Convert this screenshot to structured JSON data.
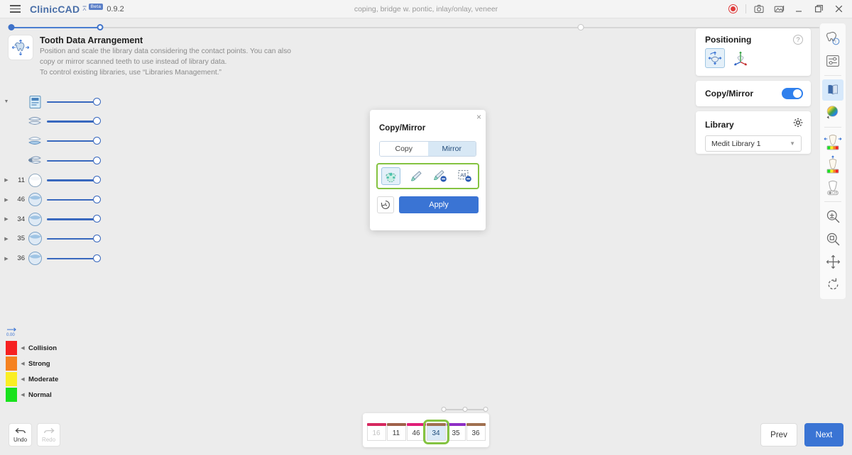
{
  "titlebar": {
    "menu_icon": "hamburger-icon",
    "brand": "ClinicCAD",
    "brand_mark": "⩞",
    "beta": "Beta",
    "version": "0.9.2",
    "center_title": "coping, bridge w. pontic, inlay/onlay, veneer",
    "controls": [
      {
        "name": "record-button",
        "label": "record"
      },
      {
        "name": "screenshot-button",
        "label": "screenshot"
      },
      {
        "name": "gallery-button",
        "label": "gallery"
      },
      {
        "name": "minimize-button",
        "label": "minimize"
      },
      {
        "name": "maximize-button",
        "label": "maximize"
      },
      {
        "name": "close-button",
        "label": "close"
      }
    ]
  },
  "stepper": {
    "nodes": [
      {
        "pos": 0,
        "state": "done"
      },
      {
        "pos": 11,
        "state": "current"
      },
      {
        "pos": 68.5,
        "state": "todo"
      },
      {
        "pos": 100,
        "state": "todo"
      }
    ],
    "fill_percent": 11
  },
  "instruction": {
    "icon": "tooth-arrange-icon",
    "title": "Tooth Data Arrangement",
    "line1": "Position and scale the library data considering the contact points. You can also",
    "line2": "copy or mirror scanned teeth to use instead of library data.",
    "line3": "To control existing libraries, use “Libraries Management.”"
  },
  "sidebar": {
    "rows": [
      {
        "caret": "down",
        "num": "",
        "icon": "document-layer-icon",
        "expanded": true
      },
      {
        "caret": "",
        "num": "",
        "icon": "upper-lower-arch-icon"
      },
      {
        "caret": "",
        "num": "",
        "icon": "lower-arch-icon"
      },
      {
        "caret": "",
        "num": "",
        "icon": "die-model-icon"
      },
      {
        "caret": "right",
        "num": "11",
        "icon": "tooth-11-icon"
      },
      {
        "caret": "right",
        "num": "46",
        "icon": "tooth-46-icon"
      },
      {
        "caret": "right",
        "num": "34",
        "icon": "tooth-34-icon"
      },
      {
        "caret": "right",
        "num": "35",
        "icon": "tooth-35-icon"
      },
      {
        "caret": "right",
        "num": "36",
        "icon": "tooth-36-icon"
      }
    ]
  },
  "legend": {
    "scale_icon": "distance-scale-icon",
    "items": [
      {
        "label": "Collision",
        "color": "#f62121"
      },
      {
        "label": "Strong",
        "color": "#f58220"
      },
      {
        "label": "Moderate",
        "color": "#faee24"
      },
      {
        "label": "Normal",
        "color": "#18e21d"
      }
    ]
  },
  "dialog": {
    "title": "Copy/Mirror",
    "close_icon": "close-icon",
    "tabs": [
      {
        "label": "Copy",
        "active": false
      },
      {
        "label": "Mirror",
        "active": true
      }
    ],
    "tools": [
      {
        "name": "auto-select-tool",
        "selected": true
      },
      {
        "name": "brush-add-tool",
        "selected": false
      },
      {
        "name": "brush-remove-tool",
        "selected": false
      },
      {
        "name": "deselect-all-tool",
        "selected": false,
        "label": "All"
      }
    ],
    "reset_icon": "reset-history-icon",
    "apply_label": "Apply"
  },
  "right_panels": {
    "positioning": {
      "title": "Positioning",
      "help_icon": "help-icon",
      "help_label": "?",
      "tools": [
        {
          "name": "free-move-tool",
          "selected": true
        },
        {
          "name": "axis-align-tool",
          "selected": false
        }
      ]
    },
    "copy_mirror": {
      "title": "Copy/Mirror",
      "toggle_on": true
    },
    "library": {
      "title": "Library",
      "gear_icon": "gear-icon",
      "selected_option": "Medit Library 1",
      "chevron": "chevron-down-icon"
    }
  },
  "right_toolbar": {
    "items": [
      {
        "name": "occlusion-info-icon",
        "selected": false
      },
      {
        "name": "settings-sliders-icon",
        "selected": false
      },
      {
        "name": "section-view-icon",
        "selected": true
      },
      {
        "name": "color-wheel-icon",
        "selected": false
      },
      {
        "name": "proximal-contact-icon",
        "selected": false
      },
      {
        "name": "occlusal-contact-icon",
        "selected": false
      },
      {
        "name": "tooth-off-icon",
        "selected": false
      },
      {
        "name": "zoom-in-icon",
        "selected": false
      },
      {
        "name": "zoom-fit-icon",
        "selected": false
      },
      {
        "name": "pan-icon",
        "selected": false
      },
      {
        "name": "rotate-icon",
        "selected": false
      }
    ]
  },
  "tooth_bar": {
    "teeth": [
      {
        "num": "16",
        "color": "#d6285f",
        "selected": false,
        "disabled": true
      },
      {
        "num": "11",
        "color": "#a0614a",
        "selected": false,
        "disabled": false
      },
      {
        "num": "46",
        "color": "#e01e78",
        "selected": false,
        "disabled": false
      },
      {
        "num": "34",
        "color": "#a07050",
        "selected": true,
        "disabled": false
      },
      {
        "num": "35",
        "color": "#8e2fc4",
        "selected": false,
        "disabled": false
      },
      {
        "num": "36",
        "color": "#a07050",
        "selected": false,
        "disabled": false
      }
    ],
    "mini_nodes": [
      0,
      50,
      100
    ]
  },
  "bottom": {
    "undo": {
      "label": "Undo",
      "icon": "undo-arrow-icon",
      "disabled": false
    },
    "redo": {
      "label": "Redo",
      "icon": "redo-arrow-icon",
      "disabled": true
    },
    "prev": {
      "label": "Prev"
    },
    "next": {
      "label": "Next"
    }
  },
  "colors": {
    "accent_blue": "#3a74d4",
    "brand_blue": "#4a6fa8",
    "select_green": "#84c341",
    "gingiva_red": "#e1695c",
    "tooth_teal": "#4ecdb4",
    "tooth_ivory": "#ece3d4"
  }
}
